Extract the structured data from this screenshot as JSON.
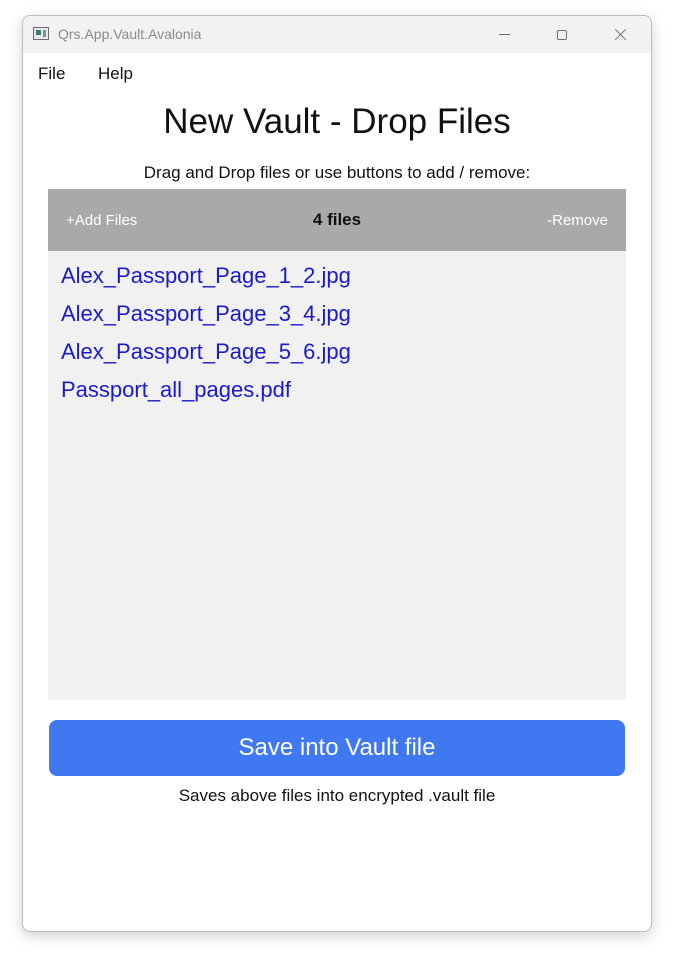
{
  "window": {
    "title": "Qrs.App.Vault.Avalonia",
    "icons": {
      "app": "app-icon",
      "minimize": "minimize-icon",
      "maximize": "maximize-icon",
      "close": "close-icon"
    }
  },
  "menu": {
    "items": [
      "File",
      "Help"
    ]
  },
  "page": {
    "title": "New Vault - Drop Files",
    "instructions": "Drag and Drop files or use buttons to add / remove:"
  },
  "file_panel": {
    "add_label": "+Add Files",
    "count_label": "4 files",
    "remove_label": "-Remove",
    "files": [
      "Alex_Passport_Page_1_2.jpg",
      "Alex_Passport_Page_3_4.jpg",
      "Alex_Passport_Page_5_6.jpg",
      "Passport_all_pages.pdf"
    ]
  },
  "save": {
    "button_label": "Save into Vault file",
    "note": "Saves above files into encrypted .vault file"
  },
  "colors": {
    "accent": "#4078f2",
    "toolbar": "#a9a9a9",
    "panel": "#f1f1f1",
    "link": "#1a1acc"
  }
}
